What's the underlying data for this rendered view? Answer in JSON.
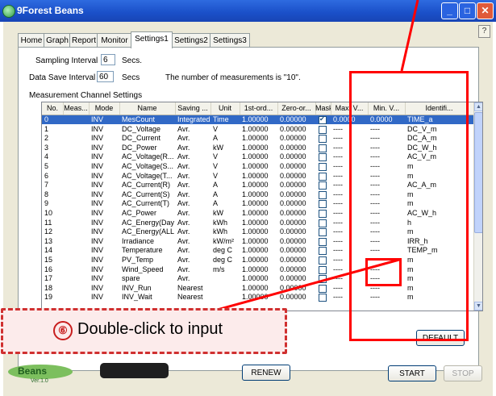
{
  "window": {
    "title": "9Forest Beans",
    "help": "?"
  },
  "tabs": [
    "Home",
    "Graph",
    "Report",
    "Monitor",
    "Settings1",
    "Settings2",
    "Settings3"
  ],
  "active_tab": "Settings1",
  "settings": {
    "sampling_label": "Sampling Interval",
    "sampling_value": "6",
    "sampling_unit": "Secs.",
    "save_label": "Data Save Interval",
    "save_value": "60",
    "save_unit": "Secs",
    "measurements_note": "The number of measurements is \"10\"."
  },
  "grid_section_label": "Measurement Channel Settings",
  "columns": [
    "No.",
    "Meas...",
    "Mode",
    "Name",
    "Saving ...",
    "Unit",
    "1st-ord...",
    "Zero-or...",
    "Mask",
    "Max. V...",
    "Min. V...",
    "Identifi..."
  ],
  "rows": [
    {
      "no": "0",
      "mode": "INV",
      "name": "MesCount",
      "saving": "Integrated",
      "unit": "Time",
      "first": "1.00000",
      "zero": "0.00000",
      "mask": true,
      "max": "0.0000",
      "min": "0.0000",
      "ident": "TIME_a"
    },
    {
      "no": "1",
      "mode": "INV",
      "name": "DC_Voltage",
      "saving": "Avr.",
      "unit": "V",
      "first": "1.00000",
      "zero": "0.00000",
      "mask": false,
      "max": "----",
      "min": "----",
      "ident": "DC_V_m"
    },
    {
      "no": "2",
      "mode": "INV",
      "name": "DC_Current",
      "saving": "Avr.",
      "unit": "A",
      "first": "1.00000",
      "zero": "0.00000",
      "mask": false,
      "max": "----",
      "min": "----",
      "ident": "DC_A_m"
    },
    {
      "no": "3",
      "mode": "INV",
      "name": "DC_Power",
      "saving": "Avr.",
      "unit": "kW",
      "first": "1.00000",
      "zero": "0.00000",
      "mask": false,
      "max": "----",
      "min": "----",
      "ident": "DC_W_h"
    },
    {
      "no": "4",
      "mode": "INV",
      "name": "AC_Voltage(R...",
      "saving": "Avr.",
      "unit": "V",
      "first": "1.00000",
      "zero": "0.00000",
      "mask": false,
      "max": "----",
      "min": "----",
      "ident": "AC_V_m"
    },
    {
      "no": "5",
      "mode": "INV",
      "name": "AC_Voltage(S...",
      "saving": "Avr.",
      "unit": "V",
      "first": "1.00000",
      "zero": "0.00000",
      "mask": false,
      "max": "----",
      "min": "----",
      "ident": "m"
    },
    {
      "no": "6",
      "mode": "INV",
      "name": "AC_Voltage(T...",
      "saving": "Avr.",
      "unit": "V",
      "first": "1.00000",
      "zero": "0.00000",
      "mask": false,
      "max": "----",
      "min": "----",
      "ident": "m"
    },
    {
      "no": "7",
      "mode": "INV",
      "name": "AC_Current(R)",
      "saving": "Avr.",
      "unit": "A",
      "first": "1.00000",
      "zero": "0.00000",
      "mask": false,
      "max": "----",
      "min": "----",
      "ident": "AC_A_m"
    },
    {
      "no": "8",
      "mode": "INV",
      "name": "AC_Current(S)",
      "saving": "Avr.",
      "unit": "A",
      "first": "1.00000",
      "zero": "0.00000",
      "mask": false,
      "max": "----",
      "min": "----",
      "ident": "m"
    },
    {
      "no": "9",
      "mode": "INV",
      "name": "AC_Current(T)",
      "saving": "Avr.",
      "unit": "A",
      "first": "1.00000",
      "zero": "0.00000",
      "mask": false,
      "max": "----",
      "min": "----",
      "ident": "m"
    },
    {
      "no": "10",
      "mode": "INV",
      "name": "AC_Power",
      "saving": "Avr.",
      "unit": "kW",
      "first": "1.00000",
      "zero": "0.00000",
      "mask": false,
      "max": "----",
      "min": "----",
      "ident": "AC_W_h"
    },
    {
      "no": "11",
      "mode": "INV",
      "name": "AC_Energy(Day)",
      "saving": "Avr.",
      "unit": "kWh",
      "first": "1.00000",
      "zero": "0.00000",
      "mask": false,
      "max": "----",
      "min": "----",
      "ident": "h"
    },
    {
      "no": "12",
      "mode": "INV",
      "name": "AC_Energy(ALL)",
      "saving": "Avr.",
      "unit": "kWh",
      "first": "1.00000",
      "zero": "0.00000",
      "mask": false,
      "max": "----",
      "min": "----",
      "ident": "m"
    },
    {
      "no": "13",
      "mode": "INV",
      "name": "Irradiance",
      "saving": "Avr.",
      "unit": "kW/m²",
      "first": "1.00000",
      "zero": "0.00000",
      "mask": false,
      "max": "----",
      "min": "----",
      "ident": "IRR_h"
    },
    {
      "no": "14",
      "mode": "INV",
      "name": "Temperature",
      "saving": "Avr.",
      "unit": "deg C",
      "first": "1.00000",
      "zero": "0.00000",
      "mask": false,
      "max": "----",
      "min": "----",
      "ident": "TEMP_m"
    },
    {
      "no": "15",
      "mode": "INV",
      "name": "PV_Temp",
      "saving": "Avr.",
      "unit": "deg C",
      "first": "1.00000",
      "zero": "0.00000",
      "mask": false,
      "max": "----",
      "min": "----",
      "ident": "m"
    },
    {
      "no": "16",
      "mode": "INV",
      "name": "Wind_Speed",
      "saving": "Avr.",
      "unit": "m/s",
      "first": "1.00000",
      "zero": "0.00000",
      "mask": false,
      "max": "----",
      "min": "----",
      "ident": "m"
    },
    {
      "no": "17",
      "mode": "INV",
      "name": "spare",
      "saving": "Avr.",
      "unit": "",
      "first": "1.00000",
      "zero": "0.00000",
      "mask": false,
      "max": "----",
      "min": "----",
      "ident": "m"
    },
    {
      "no": "18",
      "mode": "INV",
      "name": "INV_Run",
      "saving": "Nearest",
      "unit": "",
      "first": "1.00000",
      "zero": "0.00000",
      "mask": false,
      "max": "----",
      "min": "----",
      "ident": "m"
    },
    {
      "no": "19",
      "mode": "INV",
      "name": "INV_Wait",
      "saving": "Nearest",
      "unit": "",
      "first": "1.00000",
      "zero": "0.00000",
      "mask": false,
      "max": "----",
      "min": "----",
      "ident": "m"
    }
  ],
  "buttons": {
    "default": "DEFAULT",
    "renew": "RENEW",
    "start": "START",
    "stop": "STOP"
  },
  "logo": {
    "version": "Ver.1.0"
  },
  "callout": {
    "number": "⑥",
    "text": "Double-click to input"
  },
  "colors": {
    "titlebar": "#1a4fc8",
    "selection": "#3169c6",
    "annotation": "#ff0000"
  }
}
